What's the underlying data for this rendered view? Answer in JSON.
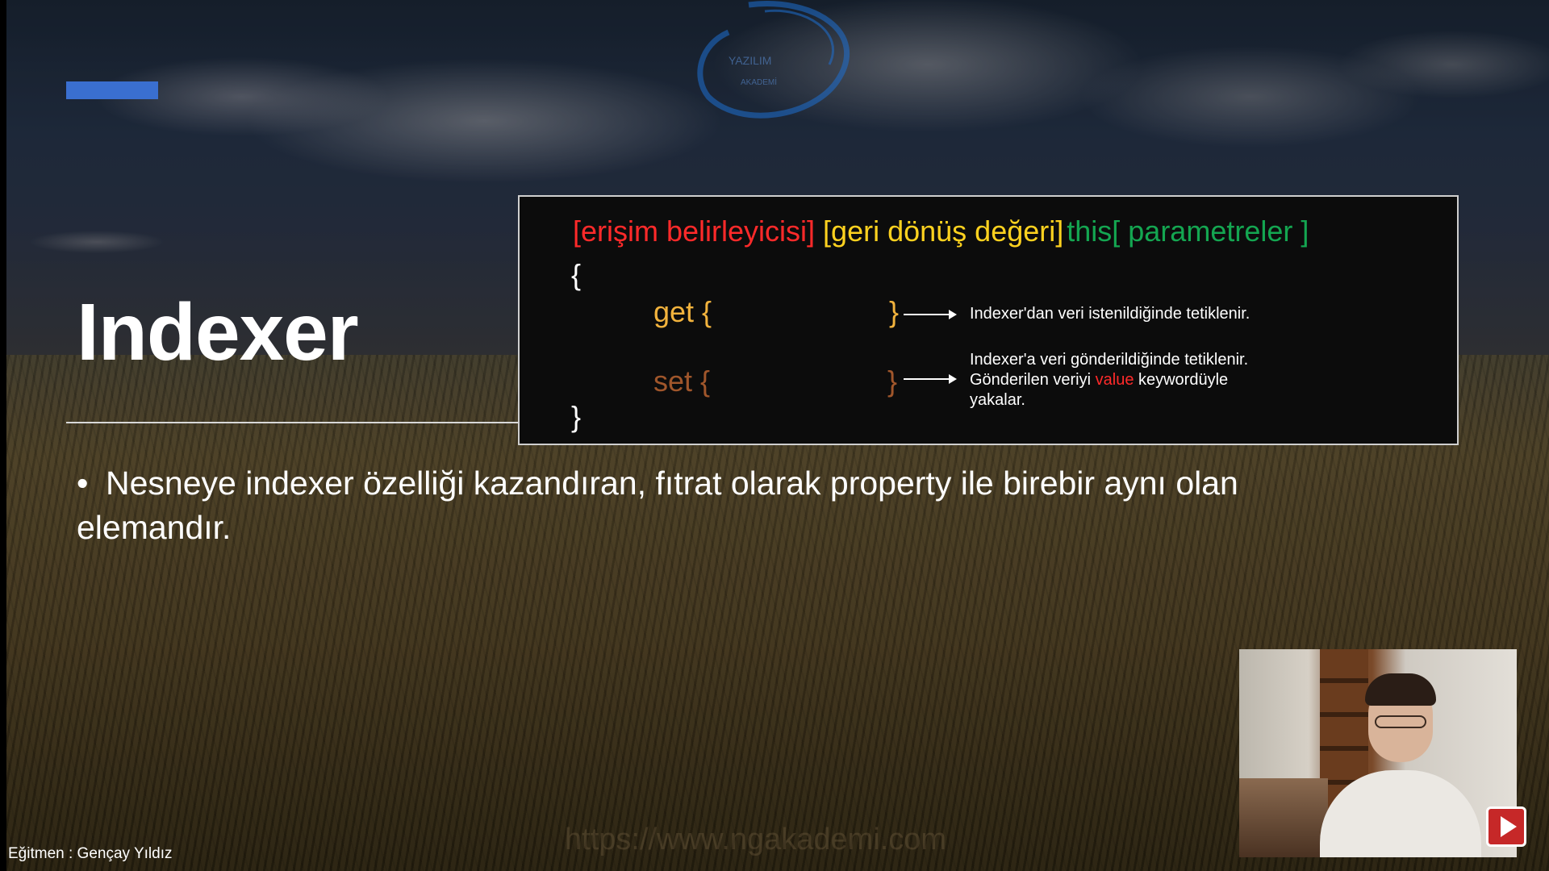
{
  "slide": {
    "title": "Indexer",
    "bullet": "Nesneye indexer özelliği kazandıran, fıtrat olarak property ile birebir aynı olan elemandır.",
    "bullet_marker": "•"
  },
  "code_box": {
    "signature": {
      "access_modifier": "[erişim belirleyicisi]",
      "return_type": "[geri dönüş değeri]",
      "this_keyword": "this[ parametreler ]"
    },
    "open_brace": "{",
    "close_brace": "}",
    "get_label": "get {",
    "get_close": "}",
    "set_label": "set {",
    "set_close": "}",
    "get_description": "Indexer'dan veri istenildiğinde tetiklenir.",
    "set_description": {
      "line1": "Indexer'a veri gönderildiğinde tetiklenir.",
      "line2_before": "Gönderilen veriyi ",
      "line2_highlight": "value",
      "line2_after": " keywordüyle",
      "line3": "yakalar."
    }
  },
  "footer": {
    "instructor": "Eğitmen : Gençay Yıldız"
  },
  "colors": {
    "accent_bar": "#3a6fd0",
    "access_modifier": "#ff2a2a",
    "return_type": "#ffd21f",
    "this_keyword": "#14a651",
    "get_keyword": "#f2b33d",
    "set_keyword": "#a0562b",
    "value_highlight": "#ff2a2a",
    "play_button": "#c62828"
  },
  "icons": {
    "logo": "circular-swoosh-logo",
    "play": "youtube-play-icon",
    "arrow": "right-arrow-icon"
  }
}
